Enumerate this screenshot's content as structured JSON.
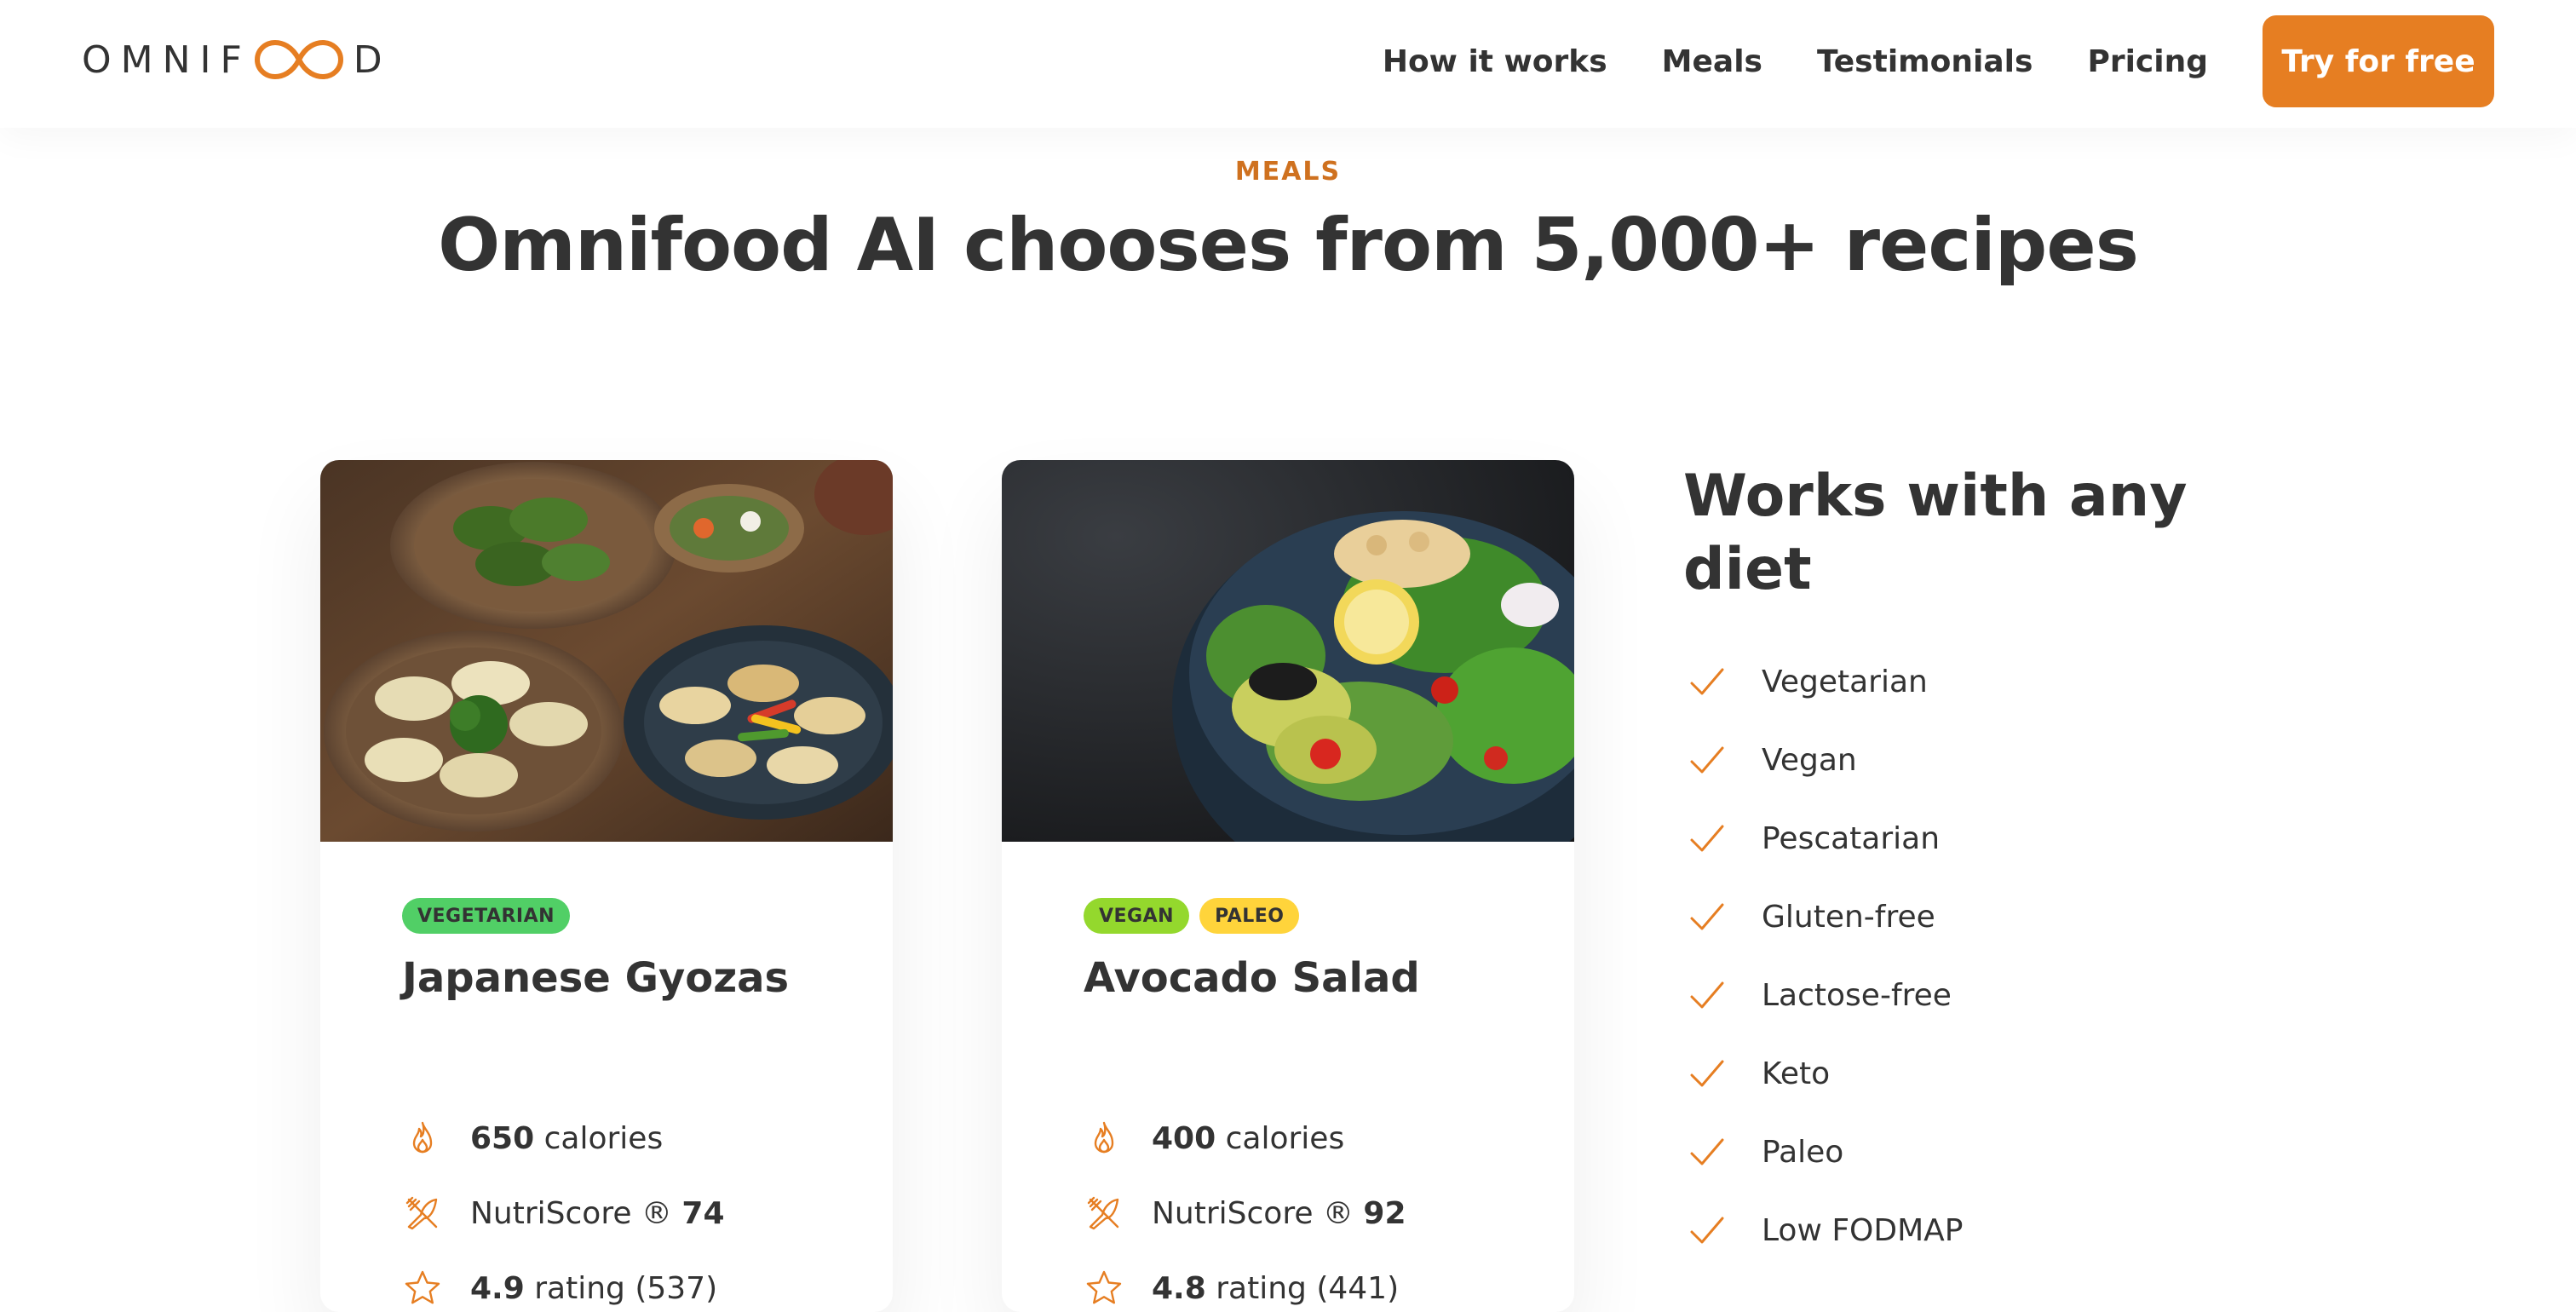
{
  "brand": {
    "logo_text_left": "OMNIF",
    "logo_text_right": "D",
    "accent": "#e67e22"
  },
  "nav": {
    "links": [
      {
        "label": "How it works"
      },
      {
        "label": "Meals"
      },
      {
        "label": "Testimonials"
      },
      {
        "label": "Pricing"
      }
    ],
    "cta_label": "Try for free"
  },
  "section": {
    "subheading": "MEALS",
    "heading": "Omnifood AI chooses from 5,000+ recipes"
  },
  "meals": [
    {
      "image_icon": "gyoza-photo",
      "tags": [
        {
          "label": "VEGETARIAN",
          "color": "#51cf66"
        }
      ],
      "title": "Japanese Gyozas",
      "calories_value": "650",
      "calories_label": "calories",
      "nutriscore_label": "NutriScore ®",
      "nutriscore_value": "74",
      "rating_value": "4.9",
      "rating_label": "rating (537)"
    },
    {
      "image_icon": "avocado-salad-photo",
      "tags": [
        {
          "label": "VEGAN",
          "color": "#94d82d"
        },
        {
          "label": "PALEO",
          "color": "#ffd43b"
        }
      ],
      "title": "Avocado Salad",
      "calories_value": "400",
      "calories_label": "calories",
      "nutriscore_label": "NutriScore ®",
      "nutriscore_value": "92",
      "rating_value": "4.8",
      "rating_label": "rating (441)"
    }
  ],
  "diets": {
    "title": "Works with any diet",
    "items": [
      "Vegetarian",
      "Vegan",
      "Pescatarian",
      "Gluten-free",
      "Lactose-free",
      "Keto",
      "Paleo",
      "Low FODMAP"
    ],
    "item_icon": "checkmark-icon"
  }
}
